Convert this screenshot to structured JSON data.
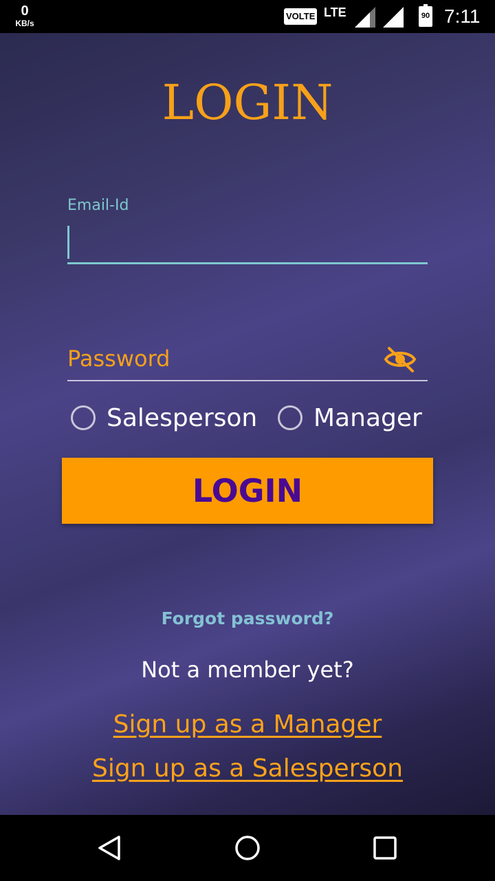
{
  "status_bar": {
    "net_speed_value": "0",
    "net_speed_unit": "KB/s",
    "volte": "VOLTE",
    "network": "LTE",
    "battery": "90",
    "time": "7:11"
  },
  "login": {
    "title": "LOGIN",
    "email_label": "Email-Id",
    "email_value": "",
    "password_placeholder": "Password",
    "roles": [
      {
        "label": "Salesperson",
        "selected": false
      },
      {
        "label": "Manager",
        "selected": false
      }
    ],
    "login_button": "LOGIN",
    "forgot_password": "Forgot password?",
    "not_member": "Not a member yet?",
    "signup_manager": "Sign up as a Manager",
    "signup_salesperson": "Sign up as a Salesperson"
  },
  "colors": {
    "accent_orange": "#fd9b00",
    "button_text": "#4a0a93",
    "teal": "#7ec8cf",
    "background_top": "#2b2a4f",
    "background_mid": "#4a4387"
  },
  "icons": {
    "password_toggle": "eye-off-icon",
    "nav_back": "back-triangle-icon",
    "nav_home": "home-circle-icon",
    "nav_recents": "recents-square-icon"
  }
}
